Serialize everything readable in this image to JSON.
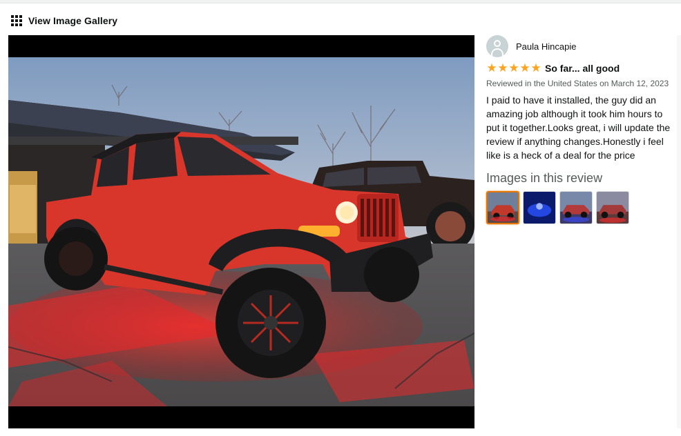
{
  "gallery": {
    "link_label": "View Image Gallery",
    "icon": "grid-icon"
  },
  "viewer": {
    "image_description_icon": "image"
  },
  "review": {
    "reviewer_name": "Paula Hincapie",
    "rating_stars": 5,
    "rating_max": 5,
    "title": "So far... all good",
    "date": "Reviewed in the United States on March 12, 2023",
    "body": "I paid to have it installed, the guy did an amazing job although it took him hours to put it together.Looks great, i will update the review if anything changes.Honestly i feel like is a heck of a deal for the price",
    "images_heading": "Images in this review",
    "thumbnails": [
      {
        "selected": true,
        "color": "#c0392b"
      },
      {
        "selected": false,
        "color": "#1f3fbf"
      },
      {
        "selected": false,
        "color": "#8a5a5a"
      },
      {
        "selected": false,
        "color": "#a33a3a"
      }
    ]
  },
  "colors": {
    "star": "#ffa41c",
    "selected_border": "#e77600",
    "jeep_red": "#d8362a",
    "underglow": "#e8282a"
  }
}
